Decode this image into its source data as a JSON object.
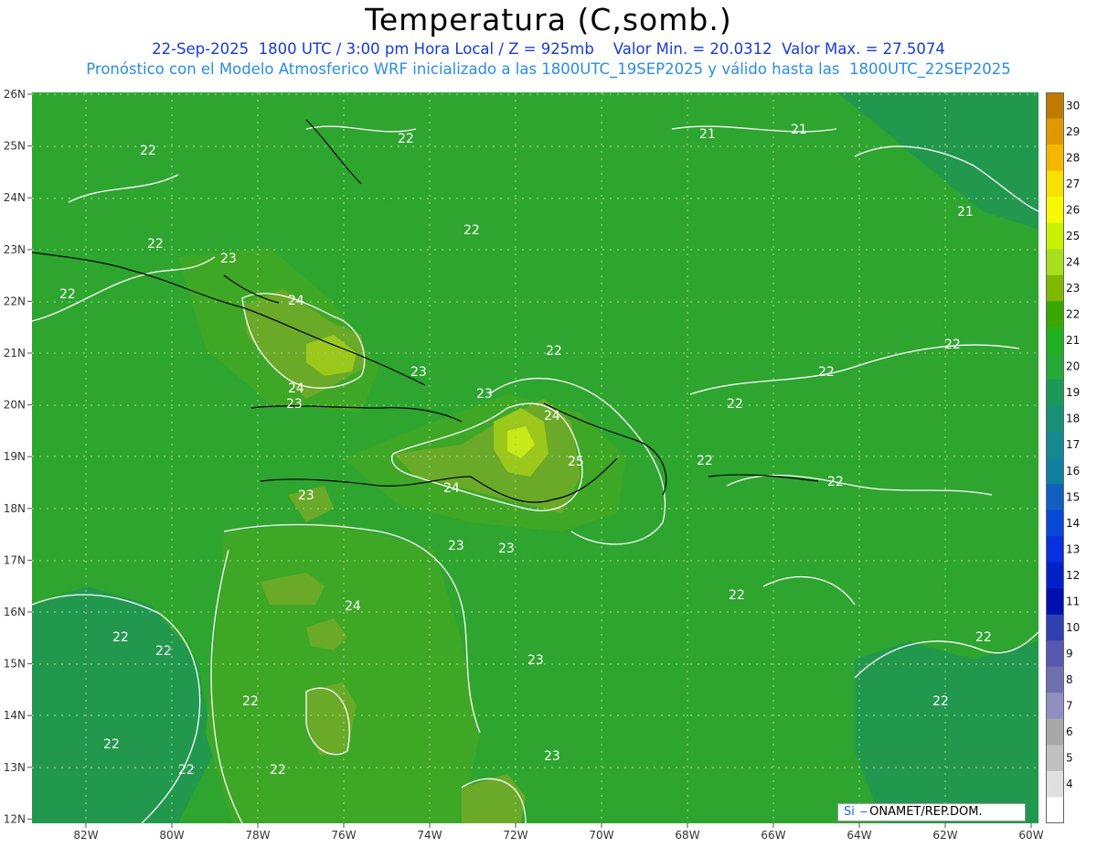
{
  "header": {
    "title": "Temperatura (C,somb.)",
    "line1": "22-Sep-2025  1800 UTC / 3:00 pm Hora Local / Z = 925mb    Valor Min. = 20.0312  Valor Max. = 27.5074",
    "line2": "Pronóstico con el Modelo Atmosferico WRF inicializado a las 1800UTC_19SEP2025 y válido hasta las  1800UTC_22SEP2025"
  },
  "axes": {
    "lat_labels": [
      "26N",
      "25N",
      "24N",
      "23N",
      "22N",
      "21N",
      "20N",
      "19N",
      "18N",
      "17N",
      "16N",
      "15N",
      "14N",
      "13N",
      "12N"
    ],
    "lon_labels": [
      "82W",
      "80W",
      "78W",
      "76W",
      "74W",
      "72W",
      "70W",
      "68W",
      "66W",
      "64W",
      "62W",
      "60W"
    ]
  },
  "colorbar": {
    "levels": [
      "30",
      "29",
      "28",
      "27",
      "26",
      "25",
      "24",
      "23",
      "22",
      "21",
      "20",
      "19",
      "18",
      "17",
      "16",
      "15",
      "14",
      "13",
      "12",
      "11",
      "10",
      "9",
      "8",
      "7",
      "6",
      "5",
      "4"
    ],
    "colors": [
      "#c07a00",
      "#e09a00",
      "#f5b800",
      "#f8e000",
      "#f8f800",
      "#c8f000",
      "#a8e020",
      "#80b800",
      "#38a800",
      "#20b020",
      "#28a838",
      "#1c9858",
      "#189078",
      "#148a90",
      "#1080a0",
      "#1060c0",
      "#0848d8",
      "#0830e0",
      "#0020c8",
      "#0010b0",
      "#3040b0",
      "#5858b0",
      "#7070b0",
      "#9090c0",
      "#a8a8a8",
      "#c0c0c0",
      "#e0e0e0",
      "#ffffff"
    ]
  },
  "contour_labels": [
    {
      "t": "22"
    },
    {
      "t": "22"
    },
    {
      "t": "21"
    },
    {
      "t": "21"
    },
    {
      "t": "21"
    },
    {
      "t": "22"
    },
    {
      "t": "22"
    },
    {
      "t": "23"
    },
    {
      "t": "22"
    },
    {
      "t": "24"
    },
    {
      "t": "22"
    },
    {
      "t": "22"
    },
    {
      "t": "23"
    },
    {
      "t": "24"
    },
    {
      "t": "23"
    },
    {
      "t": "22"
    },
    {
      "t": "23"
    },
    {
      "t": "24"
    },
    {
      "t": "25"
    },
    {
      "t": "22"
    },
    {
      "t": "22"
    },
    {
      "t": "23"
    },
    {
      "t": "24"
    },
    {
      "t": "22"
    },
    {
      "t": "23"
    },
    {
      "t": "23"
    },
    {
      "t": "24"
    },
    {
      "t": "22"
    },
    {
      "t": "22"
    },
    {
      "t": "22"
    },
    {
      "t": "22"
    },
    {
      "t": "23"
    },
    {
      "t": "22"
    },
    {
      "t": "22"
    },
    {
      "t": "22"
    },
    {
      "t": "23"
    },
    {
      "t": "22"
    },
    {
      "t": "22"
    }
  ],
  "credit": {
    "si": "Si",
    "text": "ONAMET/REP.DOM."
  },
  "field": {
    "min": 20.0312,
    "max": 27.5074,
    "level_mb": 925
  }
}
